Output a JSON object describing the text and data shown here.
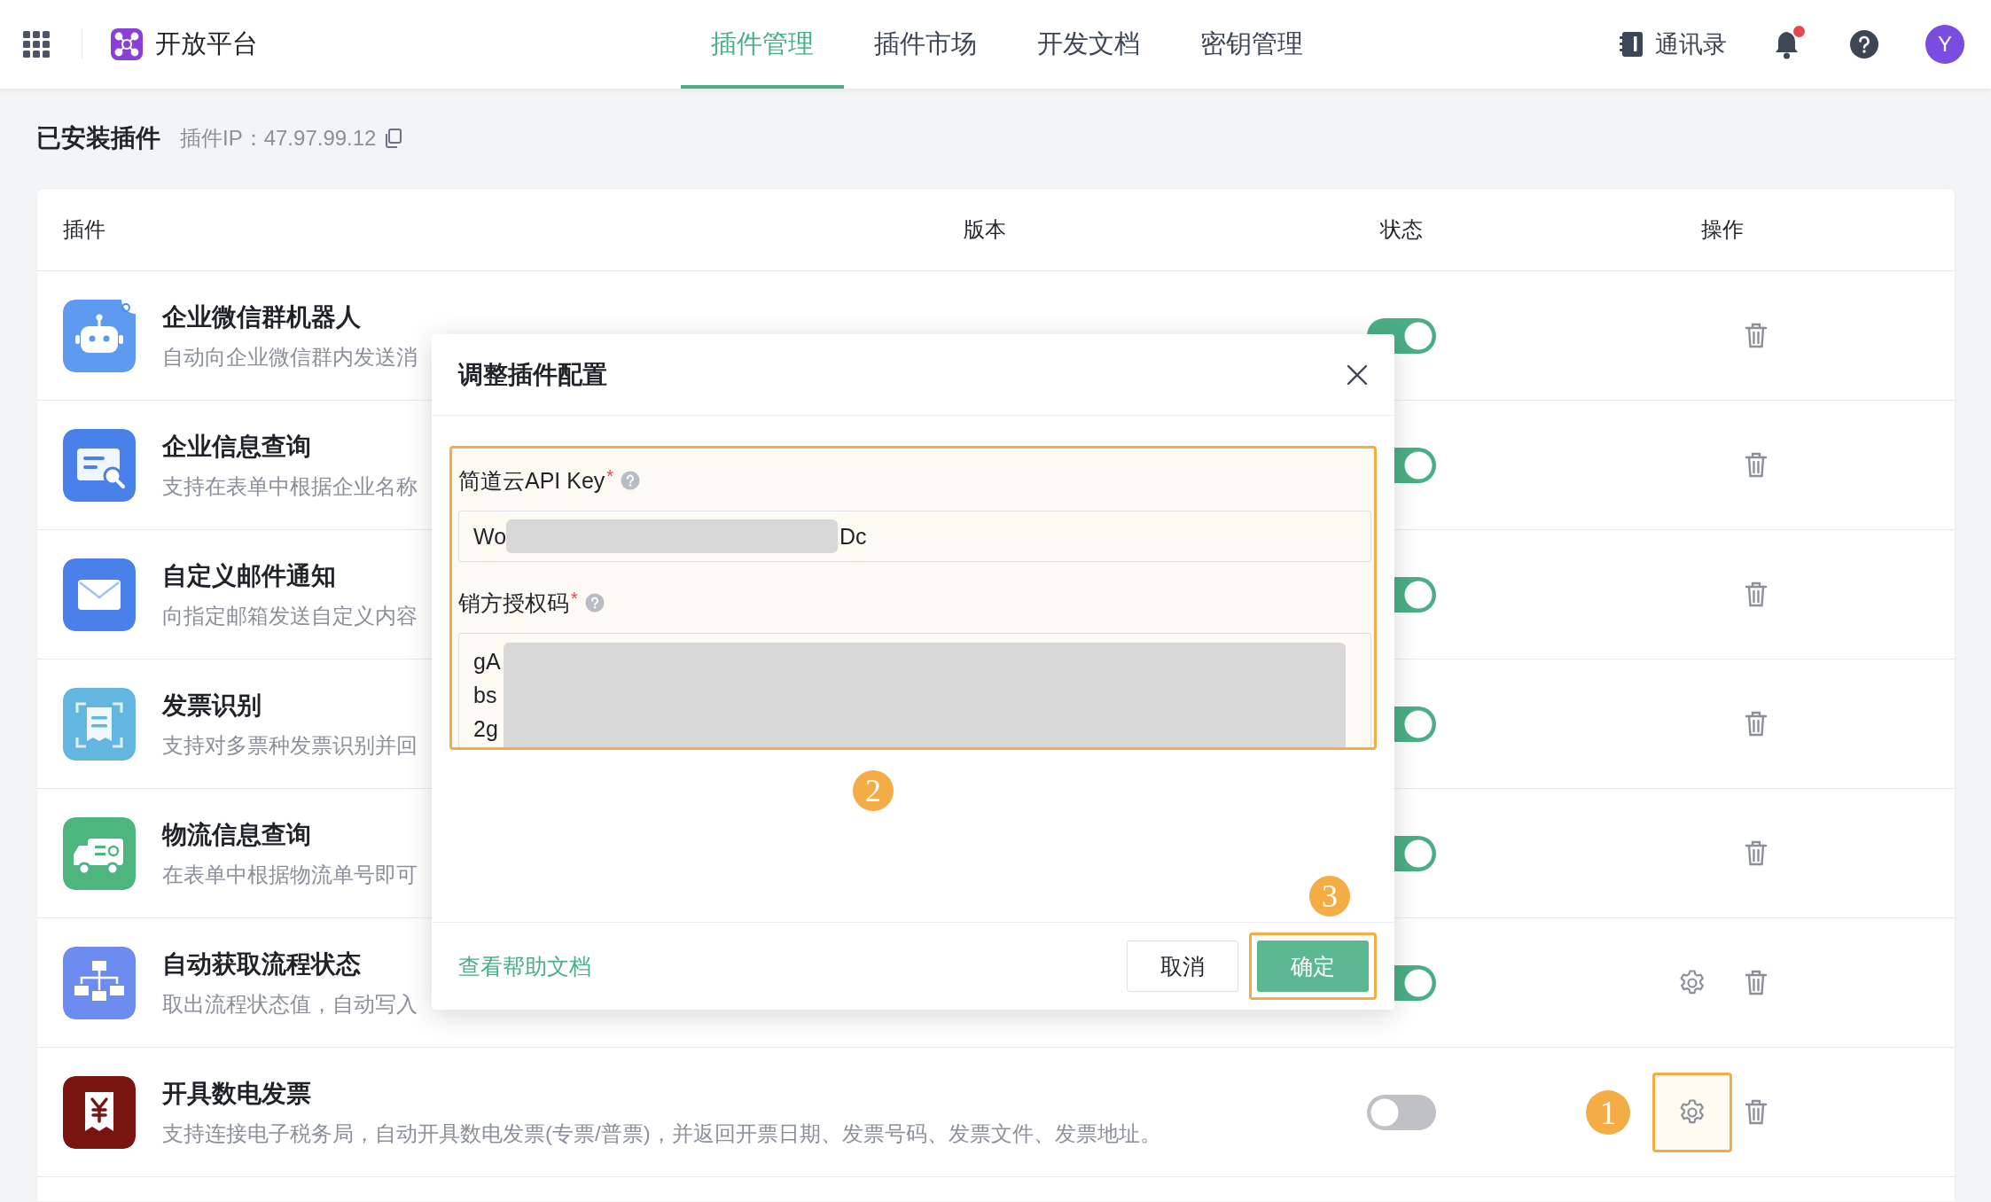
{
  "header": {
    "app_name": "开放平台",
    "nav": [
      {
        "label": "插件管理",
        "selected": true
      },
      {
        "label": "插件市场",
        "selected": false
      },
      {
        "label": "开发文档",
        "selected": false
      },
      {
        "label": "密钥管理",
        "selected": false
      }
    ],
    "contacts": "通讯录",
    "unread_notifications": true,
    "avatar": "Y"
  },
  "section": {
    "title": "已安装插件",
    "ip_label": "插件IP：47.97.99.12"
  },
  "table": {
    "columns": [
      "插件",
      "版本",
      "状态",
      "操作"
    ],
    "rows": [
      {
        "kind": "robot",
        "name": "企业微信群机器人",
        "description": "自动向企业微信群内发送消",
        "enabled": true,
        "has_settings": false
      },
      {
        "kind": "card-search",
        "name": "企业信息查询",
        "description": "支持在表单中根据企业名称",
        "enabled": true,
        "has_settings": false
      },
      {
        "kind": "mail",
        "name": "自定义邮件通知",
        "description": "向指定邮箱发送自定义内容",
        "enabled": true,
        "has_settings": false
      },
      {
        "kind": "receipt-scan",
        "name": "发票识别",
        "description": "支持对多票种发票识别并回",
        "enabled": true,
        "has_settings": false
      },
      {
        "kind": "truck",
        "name": "物流信息查询",
        "description": "在表单中根据物流单号即可",
        "enabled": true,
        "has_settings": false
      },
      {
        "kind": "flowchart",
        "name": "自动获取流程状态",
        "description": "取出流程状态值，自动写入",
        "enabled": true,
        "has_settings": true,
        "highlighted": false
      },
      {
        "kind": "yuan-receipt",
        "name": "开具数电发票",
        "description": "支持连接电子税务局，自动开具数电发票(专票/普票)，并返回开票日期、发票号码、发票文件、发票地址。",
        "enabled": false,
        "has_settings": true,
        "highlighted": true,
        "callout": "1"
      }
    ]
  },
  "modal": {
    "title": "调整插件配置",
    "fields_callout": "2",
    "fields": [
      {
        "kind": "input",
        "label": "简道云API Key",
        "required_mark": "*",
        "value_start": "Wo",
        "value_end": "Dc"
      },
      {
        "kind": "textarea",
        "label": "销方授权码",
        "required_mark": "*",
        "lines": [
          "gA",
          "bs",
          "2g"
        ]
      }
    ],
    "help_link": "查看帮助文档",
    "cancel": "取消",
    "confirm": "确定",
    "confirm_callout": "3"
  }
}
